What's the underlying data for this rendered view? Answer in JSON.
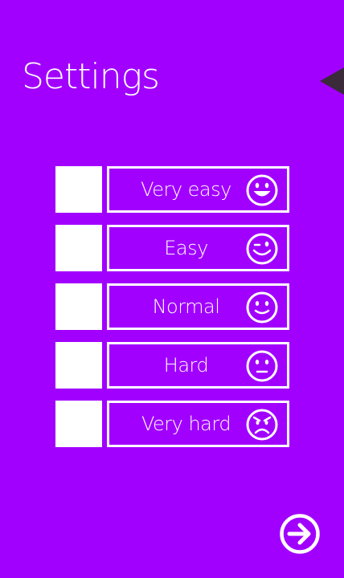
{
  "header": {
    "title": "Settings"
  },
  "navigation": {
    "back_icon": "left-triangle-icon",
    "next_icon": "arrow-right-circle-icon"
  },
  "difficulty": {
    "options": [
      {
        "label": "Very easy",
        "icon": "big-smile-icon",
        "selected": false
      },
      {
        "label": "Easy",
        "icon": "wink-icon",
        "selected": false
      },
      {
        "label": "Normal",
        "icon": "smile-icon",
        "selected": false
      },
      {
        "label": "Hard",
        "icon": "neutral-face-icon",
        "selected": false
      },
      {
        "label": "Very hard",
        "icon": "angry-face-icon",
        "selected": false
      }
    ]
  },
  "colors": {
    "background": "#a100ff",
    "foreground": "#ffffff",
    "back_arrow": "#3a2a3a"
  }
}
